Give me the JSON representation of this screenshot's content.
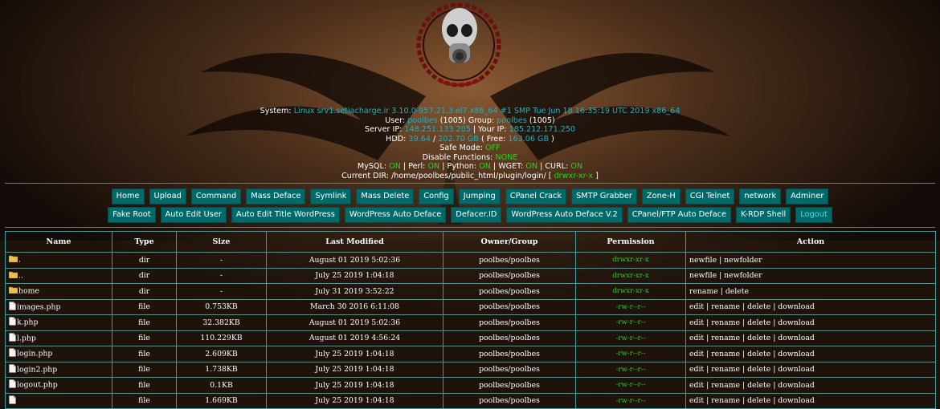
{
  "sysinfo": {
    "system_label": "System:",
    "system_value": "Linux srv1.setiacharge.ir 3.10.0-957.21.3.el7.x86_64 #1 SMP Tue Jun 18 16:35:19 UTC 2019 x86_64",
    "user_label": "User:",
    "user_value": "poolbes",
    "user_id": "(1005)",
    "group_label": "Group:",
    "group_value": "poolbes",
    "group_id": "(1005)",
    "server_ip_label": "Server IP:",
    "server_ip_value": "148.251.133.205",
    "your_ip_label": "| Your IP:",
    "your_ip_value": "185.212.171.250",
    "hdd_label": "HDD:",
    "hdd_used": "39.64",
    "hdd_sep": "/",
    "hdd_total": "202.70 GB",
    "hdd_free_label": "( Free:",
    "hdd_free": "163.06 GB",
    "hdd_close": ")",
    "safe_mode_label": "Safe Mode:",
    "safe_mode_value": "OFF",
    "disable_functions_label": "Disable Functions:",
    "disable_functions_value": "NONE",
    "mysql_label": "MySQL:",
    "mysql_value": "ON",
    "perl_label": "| Perl:",
    "perl_value": "ON",
    "python_label": "| Python:",
    "python_value": "ON",
    "wget_label": "| WGET:",
    "wget_value": "ON",
    "curl_label": "| CURL:",
    "curl_value": "ON",
    "current_dir_label": "Current DIR:",
    "current_dir_value": "/home/poolbes/public_html/plugin/login/",
    "current_dir_bracket": "[",
    "current_dir_perm": "drwxr-xr-x",
    "current_dir_bracket_close": "]"
  },
  "menu_row1": [
    "Home",
    "Upload",
    "Command",
    "Mass Deface",
    "Symlink",
    "Mass Delete",
    "Config",
    "Jumping",
    "CPanel Crack",
    "SMTP Grabber",
    "Zone-H",
    "CGI Telnet",
    "network",
    "Adminer"
  ],
  "menu_row2": [
    "Fake Root",
    "Auto Edit User",
    "Auto Edit Title WordPress",
    "WordPress Auto Deface",
    "Defacer.ID",
    "WordPress Auto Deface V.2",
    "CPanel/FTP Auto Deface",
    "K-RDP Shell",
    "Logout"
  ],
  "table": {
    "headers": [
      "Name",
      "Type",
      "Size",
      "Last Modified",
      "Owner/Group",
      "Permission",
      "Action"
    ],
    "rows": [
      {
        "name": ".",
        "type": "dir",
        "size": "-",
        "modified": "August 01 2019 5:02:36",
        "owner": "poolbes/poolbes",
        "perm": "drwxr-xr-x",
        "actions": [
          "newfile",
          "newfolder"
        ],
        "icon": "folder-icon"
      },
      {
        "name": "..",
        "type": "dir",
        "size": "-",
        "modified": "July 25 2019 1:04:18",
        "owner": "poolbes/poolbes",
        "perm": "drwxr-xr-x",
        "actions": [
          "newfile",
          "newfolder"
        ],
        "icon": "folder-icon"
      },
      {
        "name": "home",
        "type": "dir",
        "size": "-",
        "modified": "July 31 2019 3:52:22",
        "owner": "poolbes/poolbes",
        "perm": "drwxr-xr-x",
        "actions": [
          "rename",
          "delete"
        ],
        "icon": "folder-icon"
      },
      {
        "name": "images.php",
        "type": "file",
        "size": "0.753KB",
        "modified": "March 30 2016 6:11:08",
        "owner": "poolbes/poolbes",
        "perm": "-rw-r--r--",
        "actions": [
          "edit",
          "rename",
          "delete",
          "download"
        ],
        "icon": "file-icon"
      },
      {
        "name": "k.php",
        "type": "file",
        "size": "32.382KB",
        "modified": "August 01 2019 5:02:36",
        "owner": "poolbes/poolbes",
        "perm": "-rw-r--r--",
        "actions": [
          "edit",
          "rename",
          "delete",
          "download"
        ],
        "icon": "file-icon"
      },
      {
        "name": "l.php",
        "type": "file",
        "size": "110.229KB",
        "modified": "August 01 2019 4:56:24",
        "owner": "poolbes/poolbes",
        "perm": "-rw-r--r--",
        "actions": [
          "edit",
          "rename",
          "delete",
          "download"
        ],
        "icon": "file-icon"
      },
      {
        "name": "login.php",
        "type": "file",
        "size": "2.609KB",
        "modified": "July 25 2019 1:04:18",
        "owner": "poolbes/poolbes",
        "perm": "-rw-r--r--",
        "actions": [
          "edit",
          "rename",
          "delete",
          "download"
        ],
        "icon": "file-icon"
      },
      {
        "name": "login2.php",
        "type": "file",
        "size": "1.738KB",
        "modified": "July 25 2019 1:04:18",
        "owner": "poolbes/poolbes",
        "perm": "-rw-r--r--",
        "actions": [
          "edit",
          "rename",
          "delete",
          "download"
        ],
        "icon": "file-icon"
      },
      {
        "name": "logout.php",
        "type": "file",
        "size": "0.1KB",
        "modified": "July 25 2019 1:04:18",
        "owner": "poolbes/poolbes",
        "perm": "-rw-r--r--",
        "actions": [
          "edit",
          "rename",
          "delete",
          "download"
        ],
        "icon": "file-icon"
      },
      {
        "name": "",
        "type": "file",
        "size": "1.669KB",
        "modified": "July 25 2019 1:04:18",
        "owner": "poolbes/poolbes",
        "perm": "-rw-r--r--",
        "actions": [
          "edit",
          "rename",
          "delete",
          "download"
        ],
        "icon": "file-icon"
      }
    ]
  },
  "colors": {
    "accent_cyan": "#16b2c6",
    "status_green": "#1ed81e",
    "button_bg": "#006a6a",
    "table_border": "#2fa3a3"
  }
}
